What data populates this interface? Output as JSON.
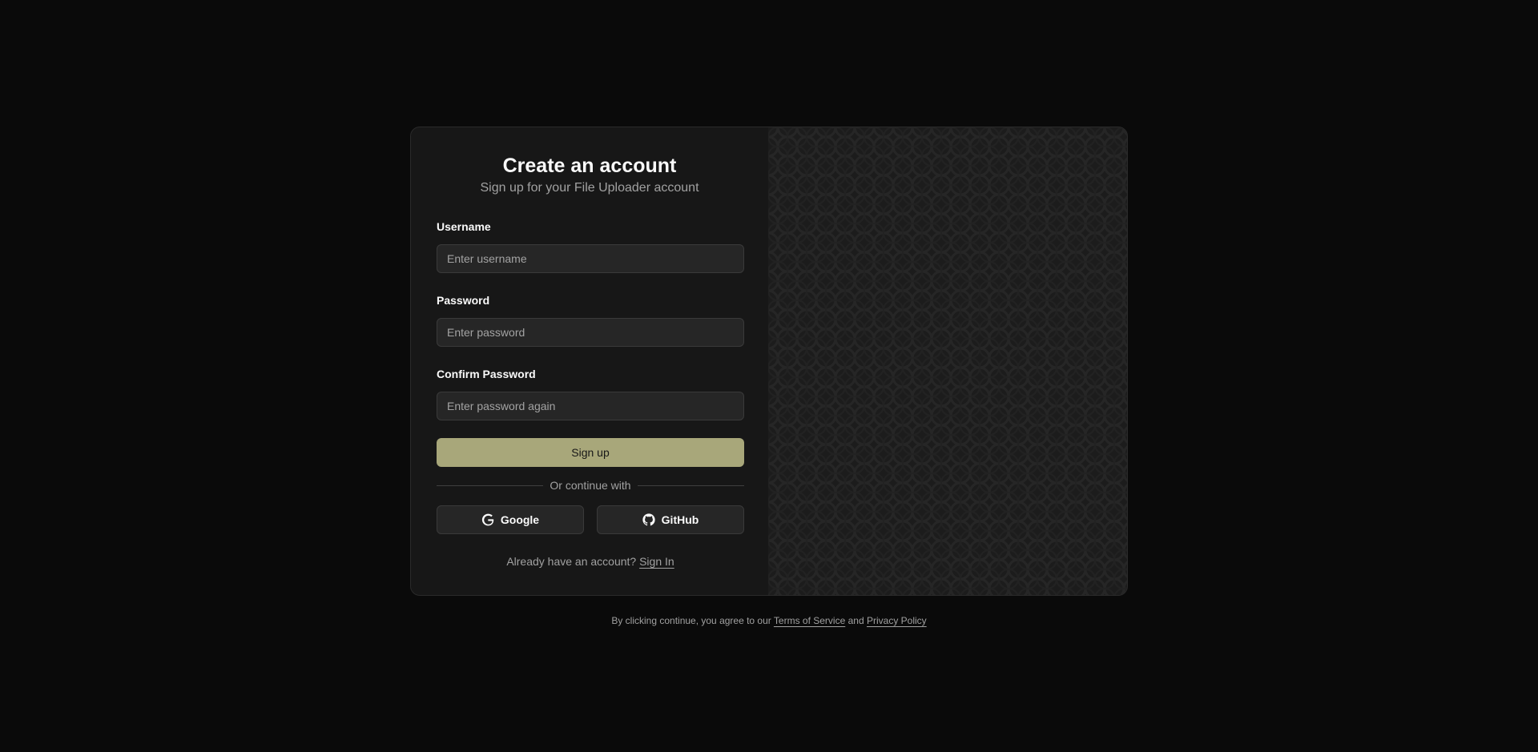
{
  "card": {
    "title": "Create an account",
    "subtitle": "Sign up for your File Uploader account"
  },
  "form": {
    "username": {
      "label": "Username",
      "placeholder": "Enter username"
    },
    "password": {
      "label": "Password",
      "placeholder": "Enter password"
    },
    "confirm_password": {
      "label": "Confirm Password",
      "placeholder": "Enter password again"
    },
    "submit_label": "Sign up"
  },
  "divider_text": "Or continue with",
  "social": {
    "google": {
      "label": "Google",
      "icon": "google-icon"
    },
    "github": {
      "label": "GitHub",
      "icon": "github-icon"
    }
  },
  "signin": {
    "prompt": "Already have an account?",
    "link": "Sign In"
  },
  "legal": {
    "prefix": "By clicking continue, you agree to our",
    "terms": "Terms of Service",
    "conjunction": "and",
    "privacy": "Privacy Policy"
  },
  "colors": {
    "page_background": "#0a0a0a",
    "card_background": "#171717",
    "primary_button": "#a8a77a",
    "pattern_background": "#1c1c1c"
  }
}
